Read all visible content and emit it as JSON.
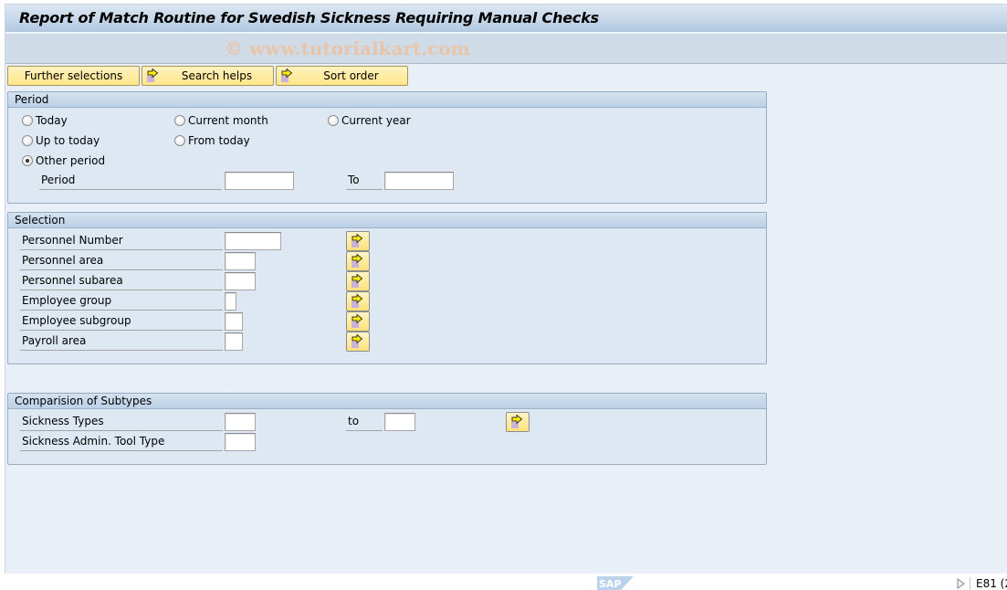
{
  "window": {
    "title": "Report of Match Routine for Swedish Sickness Requiring Manual Checks",
    "watermark": "© www.tutorialkart.com"
  },
  "toolbar": {
    "further_selections": "Further selections",
    "search_helps": "Search helps",
    "sort_order": "Sort order"
  },
  "period": {
    "header": "Period",
    "radios": [
      {
        "label": "Today",
        "checked": false
      },
      {
        "label": "Current month",
        "checked": false
      },
      {
        "label": "Current year",
        "checked": false
      },
      {
        "label": "Up to today",
        "checked": false
      },
      {
        "label": "From today",
        "checked": false
      },
      {
        "label": "Other period",
        "checked": true
      }
    ],
    "period_label": "Period",
    "period_from": "",
    "to_label": "To",
    "period_to": ""
  },
  "selection": {
    "header": "Selection",
    "fields": [
      {
        "label": "Personnel Number",
        "value": ""
      },
      {
        "label": "Personnel area",
        "value": ""
      },
      {
        "label": "Personnel subarea",
        "value": ""
      },
      {
        "label": "Employee group",
        "value": ""
      },
      {
        "label": "Employee subgroup",
        "value": ""
      },
      {
        "label": "Payroll area",
        "value": ""
      }
    ]
  },
  "subtypes": {
    "header": "Comparision of Subtypes",
    "sickness_types_label": "Sickness Types",
    "sickness_types_from": "",
    "to_label": "to",
    "sickness_types_to": "",
    "admin_tool_label": "Sickness Admin. Tool Type",
    "admin_tool_value": ""
  },
  "statusbar": {
    "logo": "SAP",
    "system": "E81 (2"
  }
}
